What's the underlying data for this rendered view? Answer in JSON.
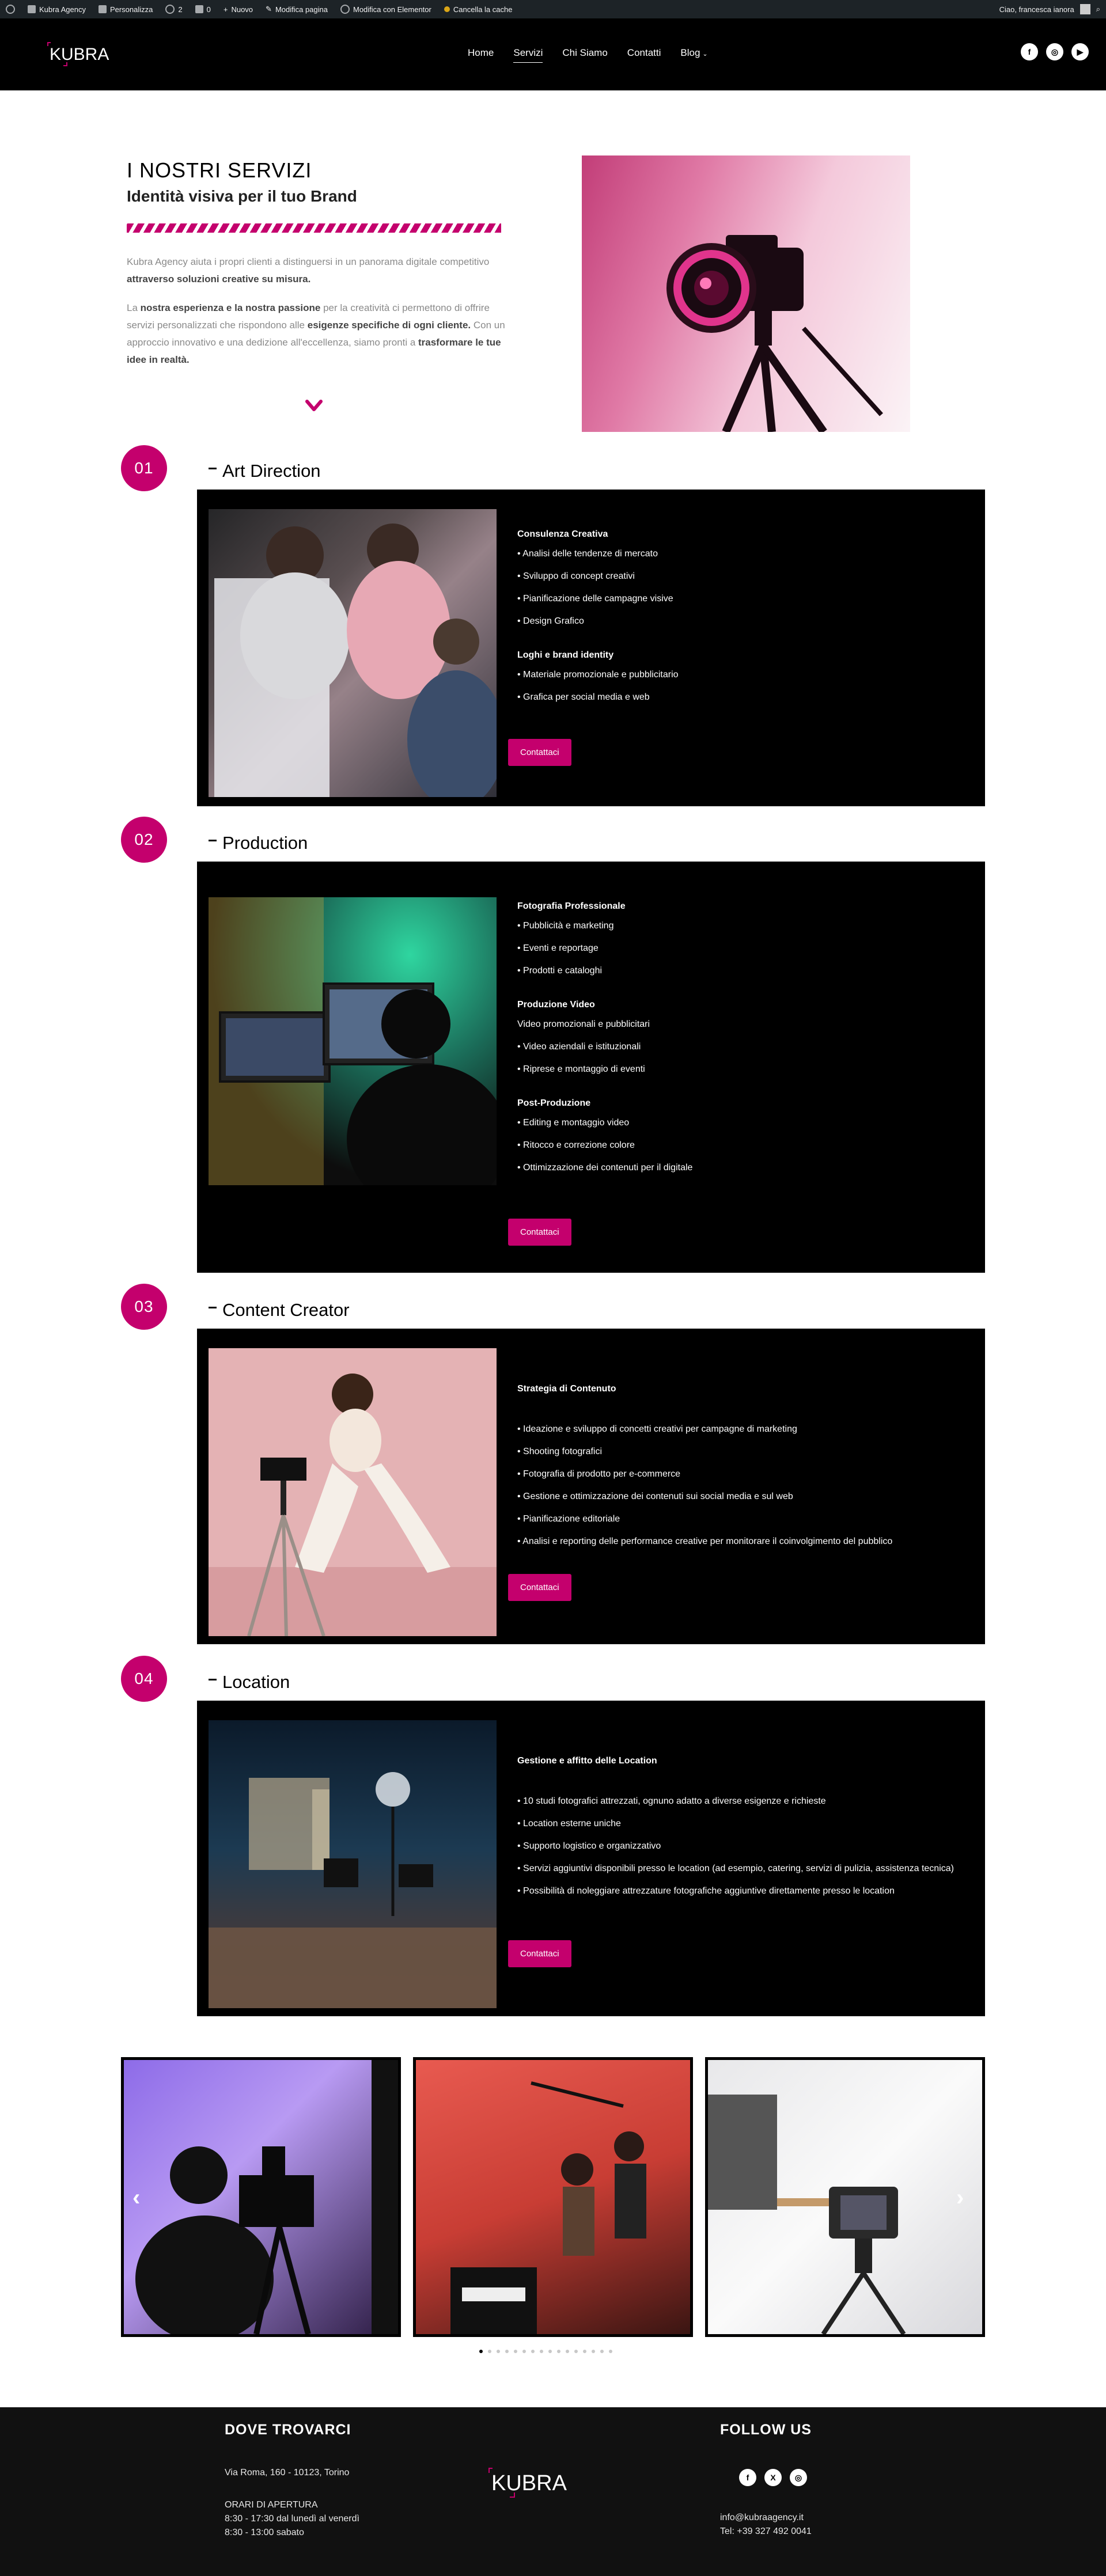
{
  "adminbar": {
    "site": "Kubra Agency",
    "customize": "Personalizza",
    "updates": "2",
    "comments": "0",
    "new": "Nuovo",
    "edit_page": "Modifica pagina",
    "elementor": "Modifica con Elementor",
    "cache": "Cancella la cache",
    "user": "Ciao, francesca ianora"
  },
  "header": {
    "logo_text": "KUBRA",
    "nav": [
      "Home",
      "Servizi",
      "Chi Siamo",
      "Contatti",
      "Blog"
    ],
    "active_nav": "Servizi"
  },
  "intro": {
    "title": "I NOSTRI SERVIZI",
    "subtitle": "Identità visiva per il tuo Brand",
    "p1_a": "Kubra Agency aiuta i propri clienti a distinguersi in un panorama digitale competitivo ",
    "p1_b": "attraverso soluzioni creative su misura.",
    "p2_a": "La ",
    "p2_b": "nostra esperienza e la nostra passione",
    "p2_c": " per la creatività ci permettono di offrire servizi personalizzati che rispondono alle ",
    "p2_d": "esigenze specifiche di ogni cliente.",
    "p2_e": " Con un approccio innovativo e una dedizione all'eccellenza, siamo pronti a ",
    "p2_f": "trasformare le tue idee in realtà."
  },
  "services": [
    {
      "num": "01",
      "title": "Art Direction",
      "groups": [
        {
          "heading": "Consulenza Creativa",
          "items": [
            "• Analisi delle tendenze di mercato",
            "• Sviluppo di concept creativi",
            "• Pianificazione delle campagne visive",
            "• Design Grafico"
          ]
        },
        {
          "heading": "Loghi e brand identity",
          "items": [
            "• Materiale promozionale e pubblicitario",
            "• Grafica per social media e web"
          ]
        }
      ],
      "button": "Contattaci"
    },
    {
      "num": "02",
      "title": "Production",
      "groups": [
        {
          "heading": "Fotografia Professionale",
          "items": [
            "• Pubblicità e marketing",
            "• Eventi e reportage",
            "• Prodotti e cataloghi"
          ]
        },
        {
          "heading": "Produzione Video",
          "items": [
            "Video promozionali e pubblicitari",
            "• Video aziendali e istituzionali",
            "• Riprese e montaggio di eventi"
          ]
        },
        {
          "heading": "Post-Produzione",
          "items": [
            "• Editing e montaggio video",
            "• Ritocco e correzione colore",
            "• Ottimizzazione dei contenuti per il digitale"
          ]
        }
      ],
      "button": "Contattaci"
    },
    {
      "num": "03",
      "title": "Content Creator",
      "groups": [
        {
          "heading": "Strategia di Contenuto",
          "items": [
            "• Ideazione e sviluppo di concetti creativi per campagne di marketing",
            "• Shooting fotografici",
            "• Fotografia di prodotto per e-commerce",
            "• Gestione e ottimizzazione dei contenuti sui social media e sul web",
            "• Pianificazione editoriale",
            "• Analisi e reporting delle performance creative per monitorare il coinvolgimento del pubblico"
          ]
        }
      ],
      "button": "Contattaci"
    },
    {
      "num": "04",
      "title": "Location",
      "groups": [
        {
          "heading": "Gestione e affitto delle Location",
          "items": [
            "• 10 studi fotografici attrezzati, ognuno adatto a diverse esigenze e richieste",
            "• Location esterne uniche",
            "• Supporto logistico e organizzativo",
            "• Servizi aggiuntivi disponibili presso le location (ad esempio, catering, servizi di pulizia, assistenza tecnica)",
            "• Possibilità di noleggiare attrezzature fotografiche aggiuntive direttamente presso le location"
          ]
        }
      ],
      "button": "Contattaci"
    }
  ],
  "carousel": {
    "prev": "‹",
    "next": "›",
    "dot_count": 16,
    "active_dot": 0
  },
  "footer": {
    "left_heading": "DOVE TROVARCI",
    "address": "Via Roma, 160 - 10123, Torino",
    "hours_label": "ORARI DI APERTURA",
    "hours_1": "8:30 - 17:30 dal lunedì al venerdì",
    "hours_2": "8:30 - 13:00 sabato",
    "logo_text": "KUBRA",
    "right_heading": "FOLLOW US",
    "email": "info@kubraagency.it",
    "phone": "Tel: +39 327 492 0041"
  },
  "colors": {
    "accent": "#c4006d",
    "dark": "#000000",
    "footer": "#111111"
  }
}
